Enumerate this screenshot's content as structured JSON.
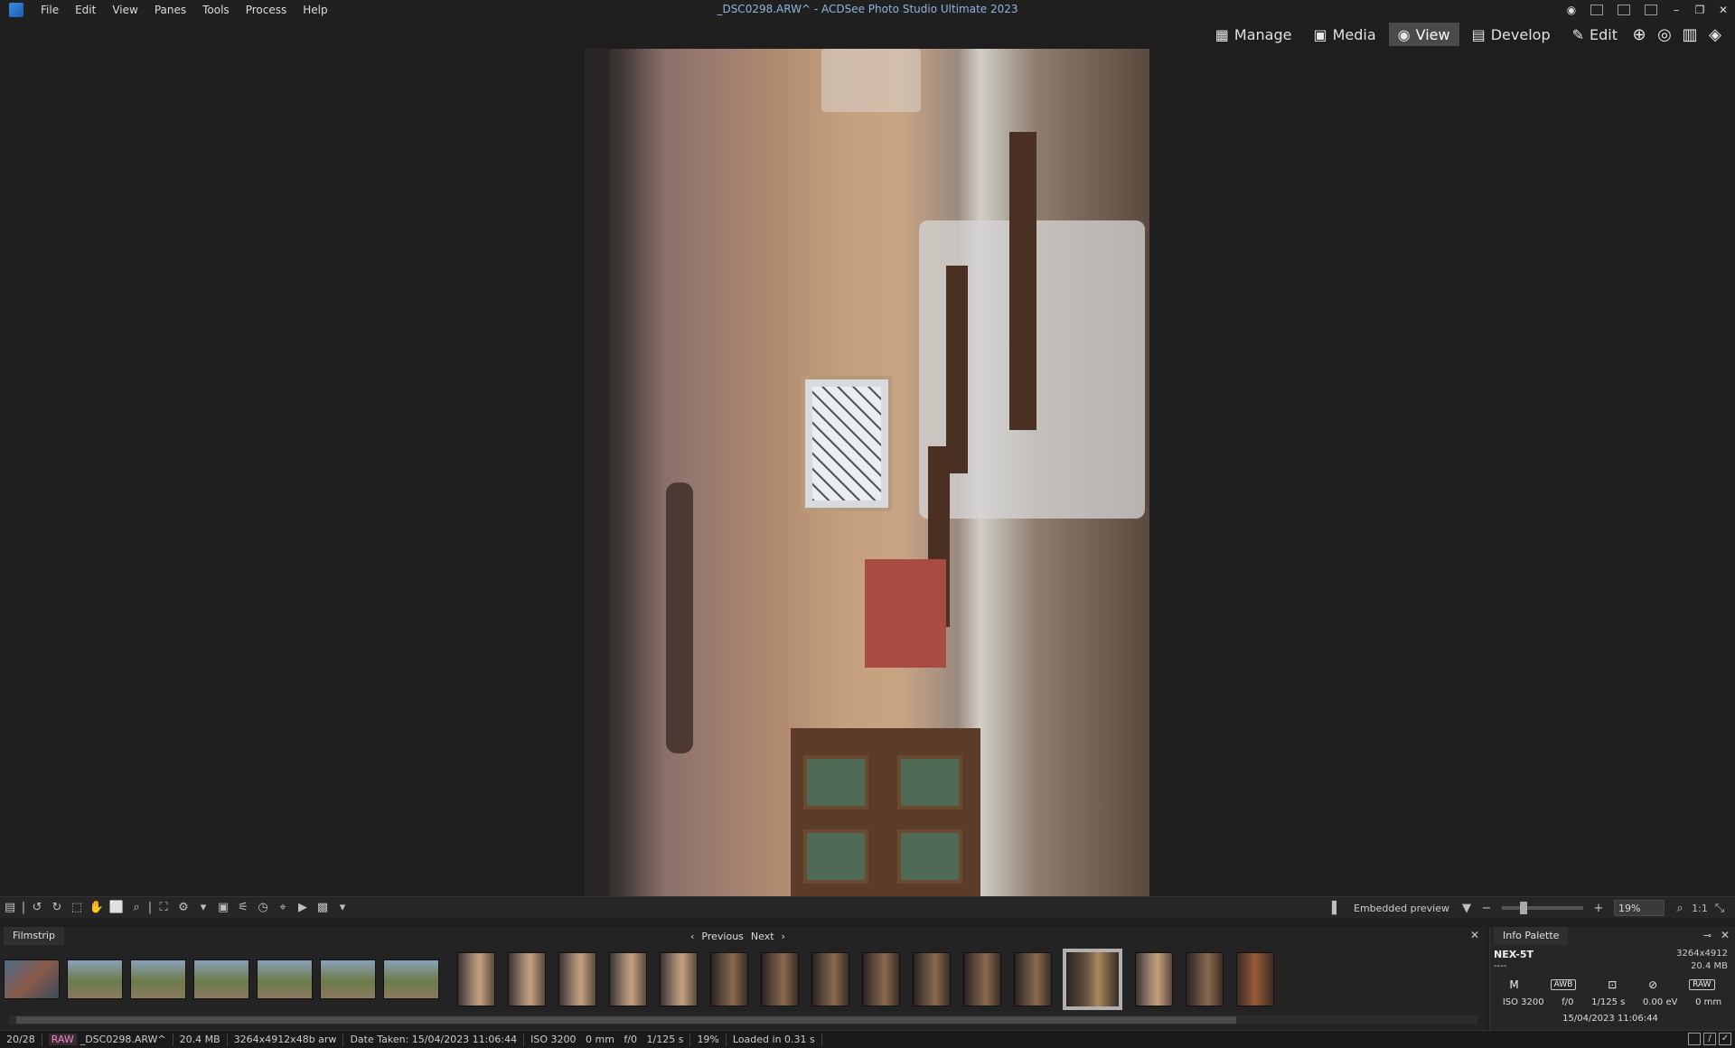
{
  "window": {
    "title": "_DSC0298.ARW^ - ACDSee Photo Studio Ultimate 2023",
    "controls": {
      "minimize": "–",
      "restore": "❐",
      "close": "✕"
    }
  },
  "menu": [
    "File",
    "Edit",
    "View",
    "Panes",
    "Tools",
    "Process",
    "Help"
  ],
  "modes": [
    {
      "label": "Manage",
      "icon": "grid-icon"
    },
    {
      "label": "Media",
      "icon": "media-icon"
    },
    {
      "label": "View",
      "icon": "eye-icon",
      "active": true
    },
    {
      "label": "Develop",
      "icon": "develop-icon"
    },
    {
      "label": "Edit",
      "icon": "edit-icon"
    }
  ],
  "toolbar": {
    "embedded_preview": "Embedded preview",
    "zoom": "19%",
    "actual_size": "1:1"
  },
  "filmstrip": {
    "tab": "Filmstrip",
    "previous": "Previous",
    "next": "Next",
    "close": "✕"
  },
  "info_palette": {
    "title": "Info Palette",
    "camera_model": "NEX-5T",
    "lens": "----",
    "dimensions": "3264x4912",
    "file_size": "20.4 MB",
    "exposure_mode": "M",
    "white_balance": "AWB",
    "format": "RAW",
    "iso": "ISO 3200",
    "aperture": "f/0",
    "shutter": "1/125 s",
    "exposure_comp": "0.00 eV",
    "focal_length": "0 mm",
    "date": "15/04/2023 11:06:44"
  },
  "status": {
    "position": "20/28",
    "raw_tag": "RAW",
    "filename": "_DSC0298.ARW^",
    "size": "20.4 MB",
    "dims": "3264x4912x48b arw",
    "date_taken": "Date Taken: 15/04/2023 11:06:44",
    "iso": "ISO 3200",
    "focal": "0 mm",
    "aperture": "f/0",
    "shutter": "1/125 s",
    "zoom": "19%",
    "loaded": "Loaded in 0.31 s"
  },
  "colors": {
    "background": "#1e1e1e",
    "title_text": "#8fb4e0",
    "active_mode": "#4a4a4a",
    "raw_tag": "#e889c0"
  }
}
